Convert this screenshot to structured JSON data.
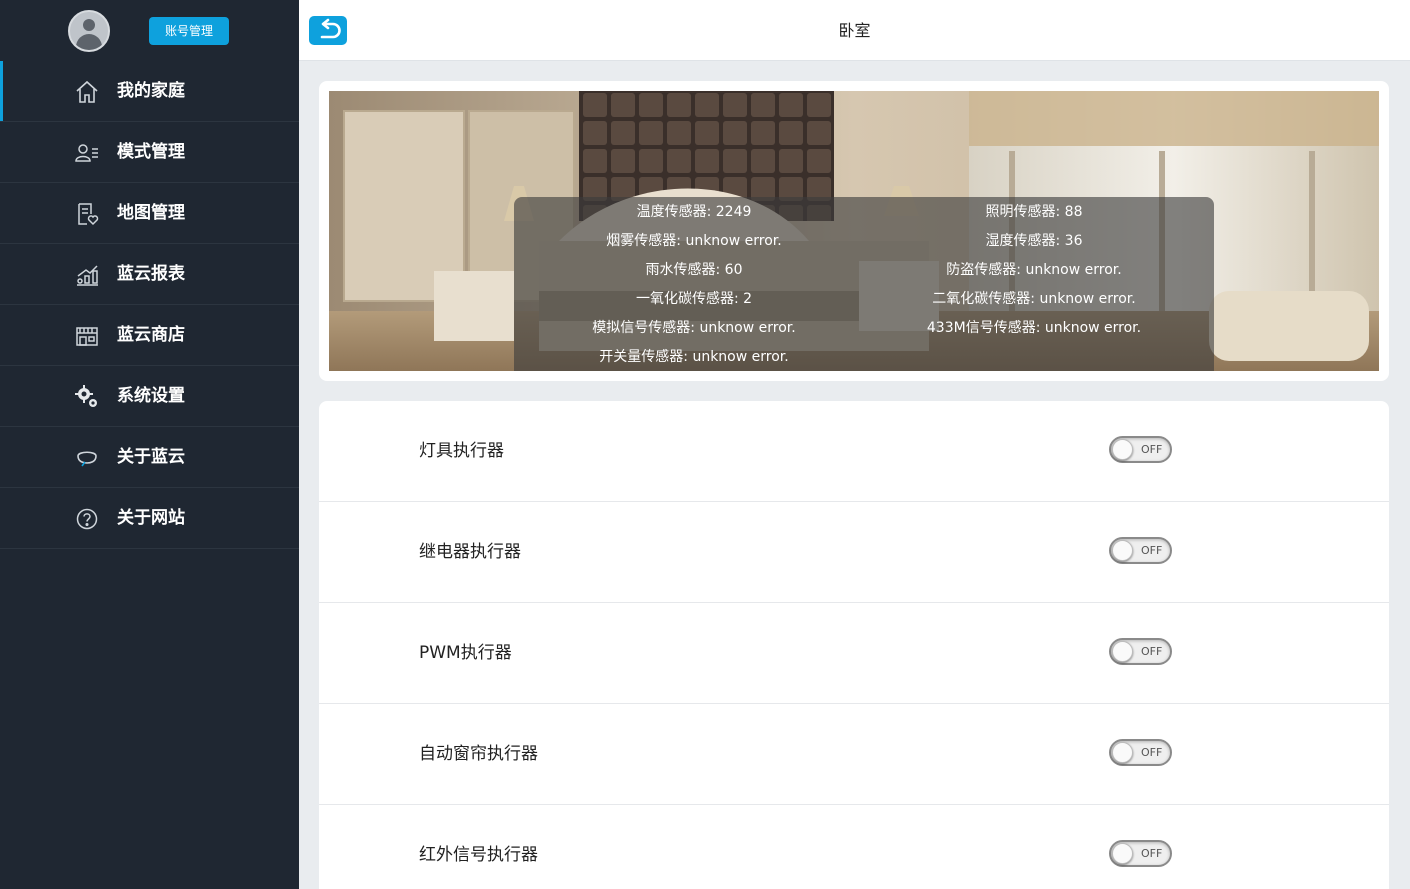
{
  "sidebar": {
    "account_button": "账号管理",
    "items": [
      {
        "label": "我的家庭",
        "icon": "home-icon",
        "active": true
      },
      {
        "label": "模式管理",
        "icon": "user-list-icon",
        "active": false
      },
      {
        "label": "地图管理",
        "icon": "document-heart-icon",
        "active": false
      },
      {
        "label": "蓝云报表",
        "icon": "bar-chart-icon",
        "active": false
      },
      {
        "label": "蓝云商店",
        "icon": "store-icon",
        "active": false
      },
      {
        "label": "系统设置",
        "icon": "gears-icon",
        "active": false
      },
      {
        "label": "关于蓝云",
        "icon": "cloud-icon",
        "active": false
      },
      {
        "label": "关于网站",
        "icon": "question-icon",
        "active": false
      }
    ]
  },
  "header": {
    "title": "卧室",
    "back_icon": "back-arrow-icon"
  },
  "sensors": {
    "left": [
      "温度传感器: 2249",
      "烟雾传感器: unknow error.",
      "雨水传感器: 60",
      "一氧化碳传感器: 2",
      "模拟信号传感器: unknow error.",
      "开关量传感器: unknow error."
    ],
    "right": [
      "照明传感器: 88",
      "湿度传感器: 36",
      "防盗传感器: unknow error.",
      "二氧化碳传感器: unknow error.",
      "433M信号传感器: unknow error."
    ]
  },
  "actuators": [
    {
      "label": "灯具执行器",
      "state": "OFF"
    },
    {
      "label": "继电器执行器",
      "state": "OFF"
    },
    {
      "label": "PWM执行器",
      "state": "OFF"
    },
    {
      "label": "自动窗帘执行器",
      "state": "OFF"
    },
    {
      "label": "红外信号执行器",
      "state": "OFF"
    }
  ],
  "colors": {
    "sidebar_bg": "#1f2732",
    "accent": "#0ea1dd"
  }
}
